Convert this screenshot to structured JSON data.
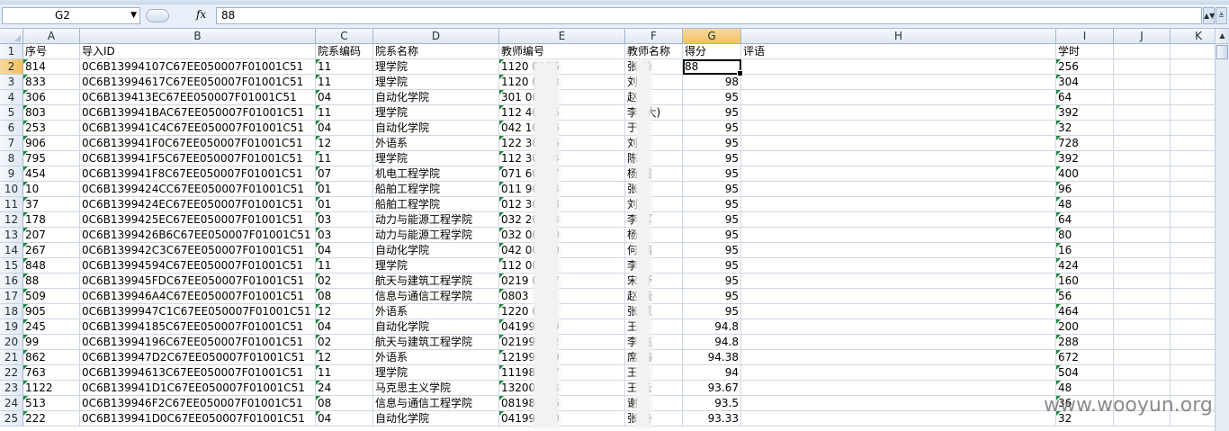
{
  "formula_bar": {
    "name_box": "G2",
    "fx_label": "fx",
    "formula": "88"
  },
  "columns": [
    {
      "letter": "A"
    },
    {
      "letter": "B"
    },
    {
      "letter": "C"
    },
    {
      "letter": "D"
    },
    {
      "letter": "E"
    },
    {
      "letter": "F"
    },
    {
      "letter": "G",
      "selected": true
    },
    {
      "letter": "H"
    },
    {
      "letter": "I"
    },
    {
      "letter": "J"
    },
    {
      "letter": "K"
    }
  ],
  "row_numbers": [
    "1",
    "2",
    "3",
    "4",
    "5",
    "6",
    "7",
    "8",
    "9",
    "10",
    "11",
    "12",
    "13",
    "14",
    "15",
    "16",
    "17",
    "18",
    "19",
    "20",
    "21",
    "22",
    "23",
    "24",
    "25"
  ],
  "headers": {
    "A": "序号",
    "B": "导入ID",
    "C": "院系编码",
    "D": "院系名称",
    "E": "教师编号",
    "F": "教师名称",
    "G": "得分",
    "H": "评语",
    "I": "学时"
  },
  "rows": [
    {
      "A": "814",
      "B": "0C6B13994107C67EE050007F01001C51",
      "C": "11",
      "D": "理学院",
      "E": "1120  0186",
      "F": "张  希",
      "G": "88",
      "I": "256"
    },
    {
      "A": "833",
      "B": "0C6B13994617C67EE050007F01001C51",
      "C": "11",
      "D": "理学院",
      "E": "1120  0193",
      "F": "刘",
      "G": "98",
      "I": "304"
    },
    {
      "A": "306",
      "B": "0C6B139413EC67EE050007F01001C51",
      "C": "04",
      "D": "自动化学院",
      "E": "301    0013",
      "F": "赵",
      "G": "95",
      "I": "64"
    },
    {
      "A": "803",
      "B": "0C6B139941BAC67EE050007F01001C51",
      "C": "11",
      "D": "理学院",
      "E": "112    40066",
      "F": "李    (大)",
      "G": "95",
      "I": "392"
    },
    {
      "A": "253",
      "B": "0C6B139941C4C67EE050007F01001C51",
      "C": "04",
      "D": "自动化学院",
      "E": "042    10086",
      "F": "于",
      "G": "95",
      "I": "32"
    },
    {
      "A": "906",
      "B": "0C6B139941F0C67EE050007F01001C51",
      "C": "12",
      "D": "外语系",
      "E": "122    30076",
      "F": "刘",
      "G": "95",
      "I": "728"
    },
    {
      "A": "795",
      "B": "0C6B139941F5C67EE050007F01001C51",
      "C": "11",
      "D": "理学院",
      "E": "112    30144",
      "F": "陈",
      "G": "95",
      "I": "392"
    },
    {
      "A": "454",
      "B": "0C6B139941F8C67EE050007F01001C51",
      "C": "07",
      "D": "机电工程学院",
      "E": "071    60077",
      "F": "杨    霞",
      "G": "95",
      "I": "400"
    },
    {
      "A": "10",
      "B": "0C6B1399424CC67EE050007F01001C51",
      "C": "01",
      "D": "船舶工程学院",
      "E": "011    90003",
      "F": "张",
      "G": "95",
      "I": "96"
    },
    {
      "A": "37",
      "B": "0C6B1399424EC67EE050007F01001C51",
      "C": "01",
      "D": "船舶工程学院",
      "E": "012    30168",
      "F": "刘",
      "G": "95",
      "I": "48"
    },
    {
      "A": "178",
      "B": "0C6B1399425EC67EE050007F01001C51",
      "C": "03",
      "D": "动力与能源工程学院",
      "E": "032    20113",
      "F": "李    军",
      "G": "95",
      "I": "64"
    },
    {
      "A": "207",
      "B": "0C6B1399426B6C67EE050007F01001C51",
      "C": "03",
      "D": "动力与能源工程学院",
      "E": "032    00050",
      "F": "杨",
      "G": "95",
      "I": "80"
    },
    {
      "A": "267",
      "B": "0C6B139942C3C67EE050007F01001C51",
      "C": "04",
      "D": "自动化学院",
      "E": "042    00200",
      "F": "何    鹏",
      "G": "95",
      "I": "16"
    },
    {
      "A": "848",
      "B": "0C6B13994594C67EE050007F01001C51",
      "C": "11",
      "D": "理学院",
      "E": "112    0020",
      "F": "李",
      "G": "95",
      "I": "424"
    },
    {
      "A": "88",
      "B": "0C6B139945FDC67EE050007F01001C51",
      "C": "02",
      "D": "航天与建筑工程学院",
      "E": "0219    0017",
      "F": "宋    舒",
      "G": "95",
      "I": "160"
    },
    {
      "A": "509",
      "B": "0C6B139946A4C67EE050007F01001C51",
      "C": "08",
      "D": "信息与通信工程学院",
      "E": "0803",
      "F": "赵    薇",
      "G": "95",
      "I": "56"
    },
    {
      "A": "905",
      "B": "0C6B1399947C1C67EE050007F01001C51",
      "C": "12",
      "D": "外语系",
      "E": "1220    087",
      "F": "张    慧",
      "G": "95",
      "I": "464"
    },
    {
      "A": "245",
      "B": "0C6B13994185C67EE050007F01001C51",
      "C": "04",
      "D": "自动化学院",
      "E": "04199    049",
      "F": "王",
      "G": "94.8",
      "I": "200"
    },
    {
      "A": "99",
      "B": "0C6B13994196C67EE050007F01001C51",
      "C": "02",
      "D": "航天与建筑工程学院",
      "E": "02199    072",
      "F": "李    亮",
      "G": "94.8",
      "I": "288"
    },
    {
      "A": "862",
      "B": "0C6B139947D2C67EE050007F01001C51",
      "C": "12",
      "D": "外语系",
      "E": "12199    019",
      "F": "席    梅",
      "G": "94.38",
      "I": "672"
    },
    {
      "A": "763",
      "B": "0C6B13994613C67EE050007F01001C51",
      "C": "11",
      "D": "理学院",
      "E": "11198    027",
      "F": "王",
      "G": "94",
      "I": "504"
    },
    {
      "A": "1122",
      "B": "0C6B139941D1C67EE050007F01001C51",
      "C": "24",
      "D": "马克思主义学院",
      "E": "13200    013",
      "F": "王    云",
      "G": "93.67",
      "I": "48"
    },
    {
      "A": "513",
      "B": "0C6B139946F2C67EE050007F01001C51",
      "C": "08",
      "D": "信息与通信工程学院",
      "E": "08198    026",
      "F": "谢",
      "G": "93.5",
      "I": "36"
    },
    {
      "A": "222",
      "B": "0C6B139941D0C67EE050007F01001C51",
      "C": "04",
      "D": "自动化学院",
      "E": "04199    020",
      "F": "张    丹",
      "G": "93.33",
      "I": "32"
    }
  ],
  "watermark": "www.wooyun.org"
}
